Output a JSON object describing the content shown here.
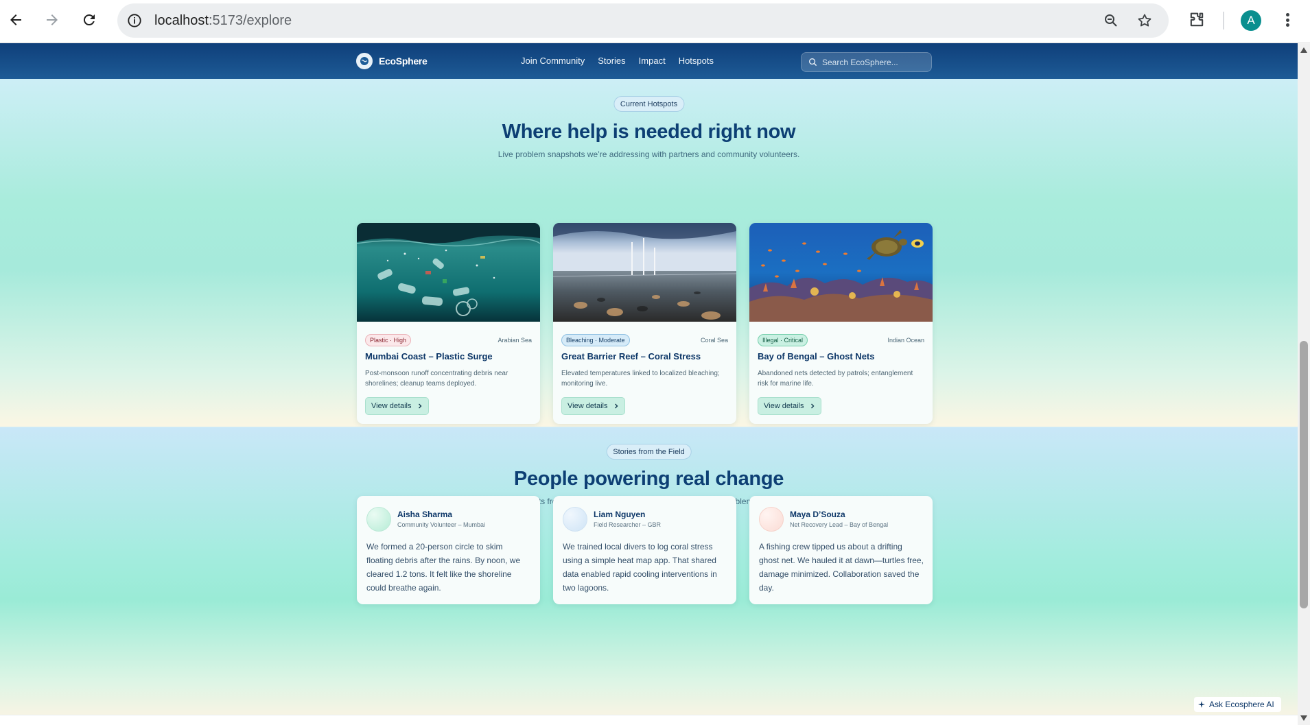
{
  "browser": {
    "url_host": "localhost",
    "url_path": ":5173/explore"
  },
  "profile": {
    "initial": "A"
  },
  "site": {
    "brand": "EcoSphere",
    "nav": [
      "Join Community",
      "Stories",
      "Impact",
      "Hotspots"
    ],
    "search_placeholder": "Search EcoSphere..."
  },
  "hotspots": {
    "pill": "Current Hotspots",
    "title": "Where help is needed right now",
    "subtitle": "Live problem snapshots we’re addressing with partners and community volunteers.",
    "cards": [
      {
        "tag": "Plastic · High",
        "region": "Arabian Sea",
        "title": "Mumbai Coast – Plastic Surge",
        "description": "Post-monsoon runoff concentrating debris near shorelines; cleanup teams deployed.",
        "button": "View details",
        "image": "plastic-underwater-image"
      },
      {
        "tag": "Bleaching · Moderate",
        "region": "Coral Sea",
        "title": "Great Barrier Reef – Coral Stress",
        "description": "Elevated temperatures linked to localized bleaching; monitoring live.",
        "button": "View details",
        "image": "shoreline-image"
      },
      {
        "tag": "Illegal · Critical",
        "region": "Indian Ocean",
        "title": "Bay of Bengal – Ghost Nets",
        "description": "Abandoned nets detected by patrols; entanglement risk for marine life.",
        "button": "View details",
        "image": "coral-reef-turtle-image"
      }
    ]
  },
  "stories": {
    "pill": "Stories from the Field",
    "title": "People powering real change",
    "subtitle": "Snapshots from volunteers and researchers solving marine problems together.",
    "cards": [
      {
        "name": "Aisha Sharma",
        "role": "Community Volunteer – Mumbai",
        "quote": "We formed a 20-person circle to skim floating debris after the rains. By noon, we cleared 1.2 tons. It felt like the shoreline could breathe again."
      },
      {
        "name": "Liam Nguyen",
        "role": "Field Researcher – GBR",
        "quote": "We trained local divers to log coral stress using a simple heat map app. That shared data enabled rapid cooling interventions in two lagoons."
      },
      {
        "name": "Maya D’Souza",
        "role": "Net Recovery Lead – Bay of Bengal",
        "quote": "A fishing crew tipped us about a drifting ghost net. We hauled it at dawn—turtles free, damage minimized. Collaboration saved the day."
      }
    ]
  },
  "assistant": {
    "label": "Ask Ecosphere AI"
  },
  "colors": {
    "header": "#0f3f7a",
    "title": "#0d3f74",
    "accent_mint": "#c9efe2",
    "profile": "#0a8f8f"
  }
}
